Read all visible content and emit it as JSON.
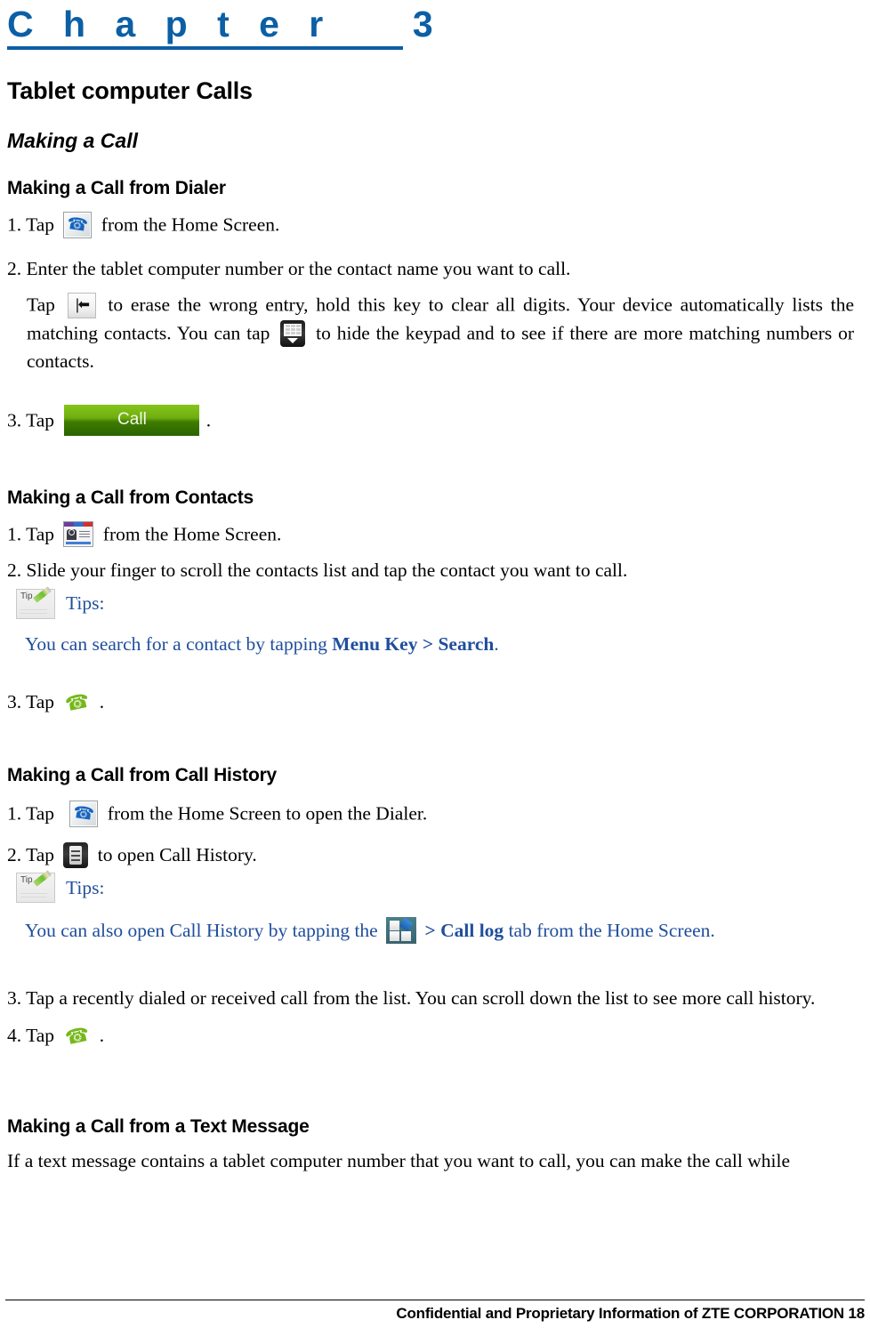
{
  "chapter": {
    "label": "C h a p t e r    3",
    "accent_color": "#0B5FA5"
  },
  "title": "Tablet computer Calls",
  "section_heading": "Making a Call",
  "sections": [
    {
      "heading": "Making a Call from Dialer",
      "steps": {
        "s1_prefix": "1. Tap",
        "s1_suffix": "from the Home Screen.",
        "s2": "2. Enter the tablet computer number or the contact name you want to call.",
        "s2_note_a": "Tap",
        "s2_note_b": "to erase the wrong entry, hold this key to clear all digits. Your device automatically lists the matching contacts. You can tap",
        "s2_note_c": "to hide the keypad and to see if there are more matching numbers or contacts.",
        "s3_prefix": "3. Tap",
        "s3_suffix": "."
      }
    },
    {
      "heading": "Making a Call from Contacts",
      "steps": {
        "s1_prefix": "1. Tap",
        "s1_suffix": "from the Home Screen.",
        "s2": "2. Slide your finger to scroll the contacts list and tap the contact you want to call.",
        "tips_label": "Tips:",
        "tips_text_a": "You can search for a contact by tapping ",
        "tips_text_bold": "Menu Key > Search",
        "tips_text_b": ".",
        "s3_prefix": "3. Tap",
        "s3_suffix": "."
      }
    },
    {
      "heading": "Making a Call from Call History",
      "steps": {
        "s1_prefix": "1. Tap",
        "s1_suffix": "from the Home Screen to open the Dialer.",
        "s2_prefix": "2. Tap",
        "s2_suffix": "to open Call History.",
        "tips_label": "Tips:",
        "tips_text_a": "You can also open Call History by tapping the",
        "tips_text_bold": "> Call log",
        "tips_text_b": " tab from the Home Screen.",
        "s3": "3. Tap a recently dialed or received call from the list. You can scroll down the list to see more call history.",
        "s4_prefix": "4. Tap",
        "s4_suffix": "."
      }
    },
    {
      "heading": "Making a Call from a Text Message",
      "steps": {
        "s1": "If a text message contains a tablet computer number that you want to call, you can make the call while"
      }
    }
  ],
  "icons": {
    "dialer": "blue-phone-handset-icon",
    "backspace": "backspace-key-icon",
    "keypad": "hide-keypad-icon",
    "call_button_label": "Call",
    "contacts": "contacts-card-icon",
    "green_phone": "green-handset-icon",
    "tips_note": "tips-note-icon",
    "call_history": "call-history-icon",
    "app_drawer": "app-drawer-icon"
  },
  "footer": {
    "text": "Confidential and Proprietary Information of ZTE CORPORATION 18"
  }
}
